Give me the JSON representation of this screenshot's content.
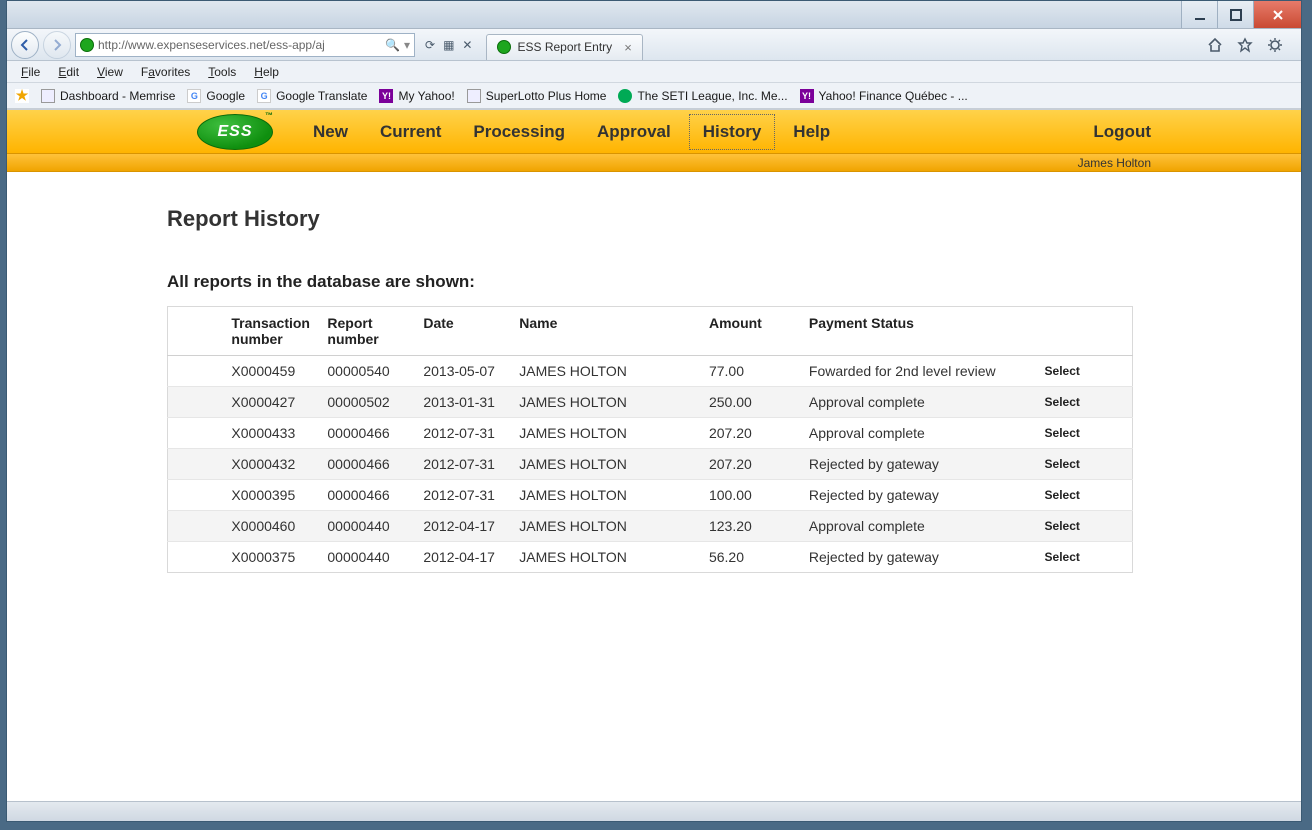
{
  "window": {
    "address": "http://www.expenseservices.net/ess-app/aj",
    "tab_title": "ESS Report Entry"
  },
  "ie_menu": [
    "File",
    "Edit",
    "View",
    "Favorites",
    "Tools",
    "Help"
  ],
  "favorites": [
    {
      "icon": "doc",
      "label": "Dashboard - Memrise"
    },
    {
      "icon": "g",
      "label": "Google"
    },
    {
      "icon": "g",
      "label": "Google Translate"
    },
    {
      "icon": "y",
      "label": "My Yahoo!"
    },
    {
      "icon": "doc",
      "label": "SuperLotto Plus Home"
    },
    {
      "icon": "seti",
      "label": "The SETI League, Inc. Me..."
    },
    {
      "icon": "y",
      "label": "Yahoo! Finance Québec - ..."
    }
  ],
  "ess": {
    "logo_text": "ESS",
    "nav": [
      {
        "label": "New",
        "active": false
      },
      {
        "label": "Current",
        "active": false
      },
      {
        "label": "Processing",
        "active": false
      },
      {
        "label": "Approval",
        "active": false
      },
      {
        "label": "History",
        "active": true
      },
      {
        "label": "Help",
        "active": false
      }
    ],
    "logout_label": "Logout",
    "username": "James Holton"
  },
  "page": {
    "title": "Report History",
    "subtitle": "All reports in the database are shown:",
    "columns": [
      "",
      "Transaction number",
      "Report number",
      "Date",
      "Name",
      "Amount",
      "Payment Status",
      ""
    ],
    "select_label": "Select",
    "rows": [
      {
        "txn": "X0000459",
        "rpt": "00000540",
        "date": "2013-05-07",
        "name": "JAMES HOLTON",
        "amount": "77.00",
        "status": "Fowarded for 2nd level review"
      },
      {
        "txn": "X0000427",
        "rpt": "00000502",
        "date": "2013-01-31",
        "name": "JAMES HOLTON",
        "amount": "250.00",
        "status": "Approval complete"
      },
      {
        "txn": "X0000433",
        "rpt": "00000466",
        "date": "2012-07-31",
        "name": "JAMES HOLTON",
        "amount": "207.20",
        "status": "Approval complete"
      },
      {
        "txn": "X0000432",
        "rpt": "00000466",
        "date": "2012-07-31",
        "name": "JAMES HOLTON",
        "amount": "207.20",
        "status": "Rejected by gateway"
      },
      {
        "txn": "X0000395",
        "rpt": "00000466",
        "date": "2012-07-31",
        "name": "JAMES HOLTON",
        "amount": "100.00",
        "status": "Rejected by gateway"
      },
      {
        "txn": "X0000460",
        "rpt": "00000440",
        "date": "2012-04-17",
        "name": "JAMES HOLTON",
        "amount": "123.20",
        "status": "Approval complete"
      },
      {
        "txn": "X0000375",
        "rpt": "00000440",
        "date": "2012-04-17",
        "name": "JAMES HOLTON",
        "amount": "56.20",
        "status": "Rejected by gateway"
      }
    ]
  }
}
